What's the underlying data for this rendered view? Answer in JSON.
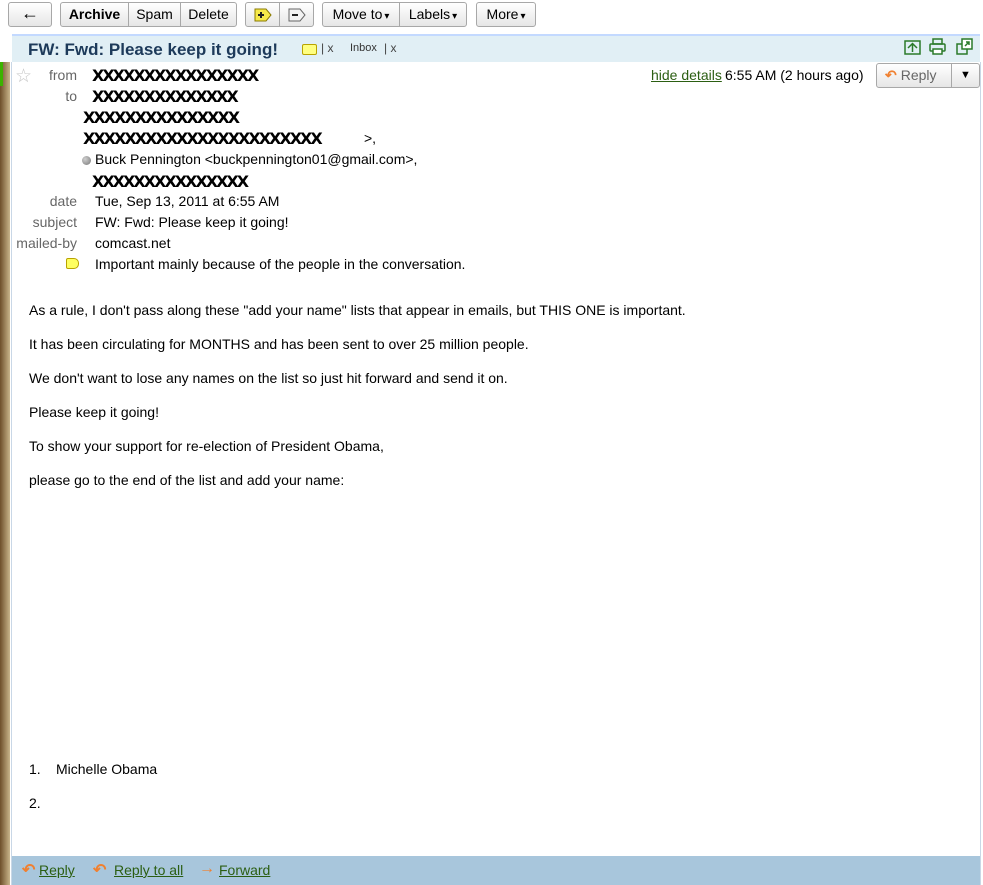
{
  "toolbar": {
    "back_glyph": "←",
    "archive": "Archive",
    "spam": "Spam",
    "delete": "Delete",
    "move_to": "Move to",
    "labels": "Labels",
    "more": "More",
    "caret": "▾"
  },
  "subject_band": {
    "title": "FW: Fwd: Please keep it going!",
    "label_x": "x",
    "inbox_label": "Inbox",
    "inbox_x": "x"
  },
  "header": {
    "from_label": "from",
    "to_label": "to",
    "date_label": "date",
    "subject_label": "subject",
    "mailed_by_label": "mailed-by",
    "recipient_visible": "Buck Pennington <buckpennington01@gmail.com>,",
    "trailing_gt": ">,",
    "date_value": "Tue, Sep 13, 2011 at 6:55 AM",
    "subject_value": "FW: Fwd: Please keep it going!",
    "mailed_by_value": "comcast.net",
    "importance_text": "Important mainly because of the people in the conversation.",
    "hide_details": "hide details",
    "time_top": "6:55 AM (2 hours ago)",
    "reply": "Reply",
    "reply_menu_caret": "▼"
  },
  "body": {
    "paragraphs": [
      "As a rule, I don't pass along these \"add your name\" lists that appear in emails, but THIS ONE  is important.",
      "It has been circulating for MONTHS and has been sent to over 25 million people.",
      "We don't want to lose any names on the list so just hit forward and send it on.",
      "Please keep it going!",
      "To show your support for re-election of President Obama,",
      "please go to the end of the list and add your name:"
    ],
    "list": [
      {
        "num": "1.",
        "text": "Michelle Obama"
      },
      {
        "num": "2.",
        "text": ""
      }
    ]
  },
  "footer": {
    "reply": "Reply",
    "reply_all": "Reply to all",
    "forward": "Forward"
  },
  "colors": {
    "subject_band_bg": "#e1eff5",
    "footer_bg": "#a8c6dc",
    "link": "#2b5e12",
    "reply_arrow": "#f08030"
  }
}
